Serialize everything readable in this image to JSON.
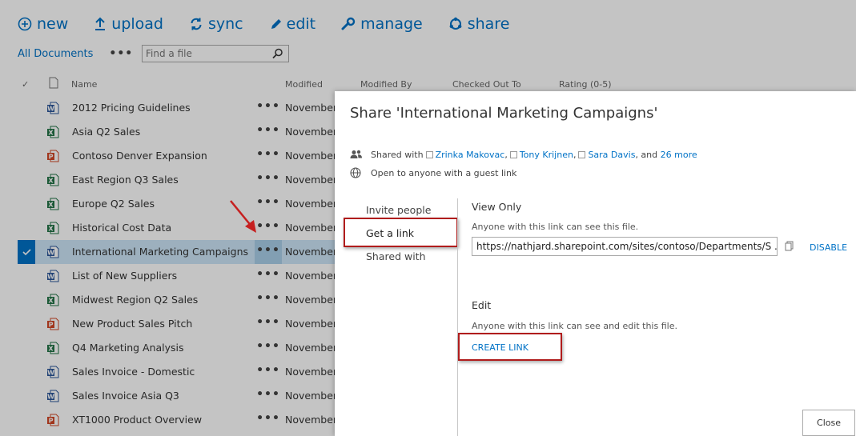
{
  "toolbar": {
    "new": "new",
    "upload": "upload",
    "sync": "sync",
    "edit": "edit",
    "manage": "manage",
    "share": "share"
  },
  "view": {
    "name": "All Documents",
    "more": "•••",
    "search_placeholder": "Find a file"
  },
  "columns": {
    "name": "Name",
    "modified": "Modified",
    "modified_by": "Modified By",
    "checked_out_to": "Checked Out To",
    "rating": "Rating (0-5)"
  },
  "files": [
    {
      "name": "2012 Pricing Guidelines",
      "type": "word",
      "modified": "November"
    },
    {
      "name": "Asia Q2 Sales",
      "type": "excel",
      "modified": "November"
    },
    {
      "name": "Contoso Denver Expansion",
      "type": "powerpoint",
      "modified": "November"
    },
    {
      "name": "East Region Q3 Sales",
      "type": "excel",
      "modified": "November"
    },
    {
      "name": "Europe Q2 Sales",
      "type": "excel",
      "modified": "November"
    },
    {
      "name": "Historical Cost Data",
      "type": "excel",
      "modified": "November"
    },
    {
      "name": "International Marketing Campaigns",
      "type": "word",
      "modified": "November",
      "selected": true
    },
    {
      "name": "List of New Suppliers",
      "type": "word",
      "modified": "November"
    },
    {
      "name": "Midwest Region Q2 Sales",
      "type": "excel",
      "modified": "November"
    },
    {
      "name": "New Product Sales Pitch",
      "type": "powerpoint",
      "modified": "November"
    },
    {
      "name": "Q4 Marketing Analysis",
      "type": "excel",
      "modified": "November"
    },
    {
      "name": "Sales Invoice - Domestic",
      "type": "word",
      "modified": "November"
    },
    {
      "name": "Sales Invoice Asia Q3",
      "type": "word",
      "modified": "November"
    },
    {
      "name": "XT1000 Product Overview",
      "type": "powerpoint",
      "modified": "November"
    }
  ],
  "row_more": "•••",
  "dialog": {
    "title": "Share 'International Marketing Campaigns'",
    "shared_with_prefix": "Shared with",
    "people": [
      "Zrinka Makovac",
      "Tony Krijnen",
      "Sara Davis"
    ],
    "and_text": ", and",
    "more_link": "26 more",
    "open_text": "Open to anyone with a guest link",
    "nav": {
      "invite": "Invite people",
      "get_link": "Get a link",
      "shared_with": "Shared with"
    },
    "view_only": {
      "title": "View Only",
      "desc": "Anyone with this link can see this file.",
      "url": "https://nathjard.sharepoint.com/sites/contoso/Departments/S ...",
      "disable": "DISABLE"
    },
    "edit": {
      "title": "Edit",
      "desc": "Anyone with this link can see and edit this file.",
      "create": "CREATE LINK"
    },
    "close": "Close"
  },
  "colors": {
    "accent": "#0072c6",
    "word": "#2b579a",
    "excel": "#217346",
    "powerpoint": "#d24726",
    "highlight": "#b01c1c"
  }
}
